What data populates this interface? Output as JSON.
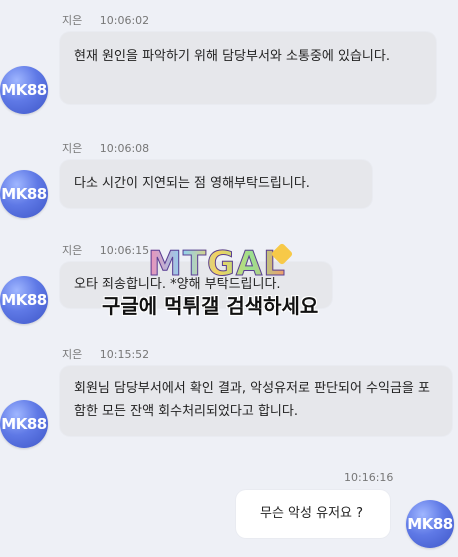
{
  "agent": {
    "avatar_label": "MK88",
    "name": "지은"
  },
  "messages": [
    {
      "time": "10:06:02",
      "text": "현재 원인을 파악하기 위해 담당부서와 소통중에 있습니다."
    },
    {
      "time": "10:06:08",
      "text": "다소 시간이 지연되는 점 영해부탁드립니다."
    },
    {
      "time": "10:06:15",
      "text": "오타 죄송합니다. *양해 부탁드립니다."
    },
    {
      "time": "10:15:52",
      "text": "회원님 담당부서에서 확인 결과, 악성유저로 판단되어 수익금을 포함한 모든 잔액 회수처리되었다고 합니다."
    }
  ],
  "user_message": {
    "time": "10:16:16",
    "text": "무슨 악성 유저요 ?",
    "avatar_label": "MK88"
  },
  "watermark": {
    "logo_text": "MTGAL",
    "caption": "구글에 먹튀갤 검색하세요"
  },
  "colors": {
    "background": "#eef0f6",
    "agent_bubble": "#e6e7eb",
    "user_bubble": "#ffffff",
    "avatar": "#4f6ad8"
  }
}
